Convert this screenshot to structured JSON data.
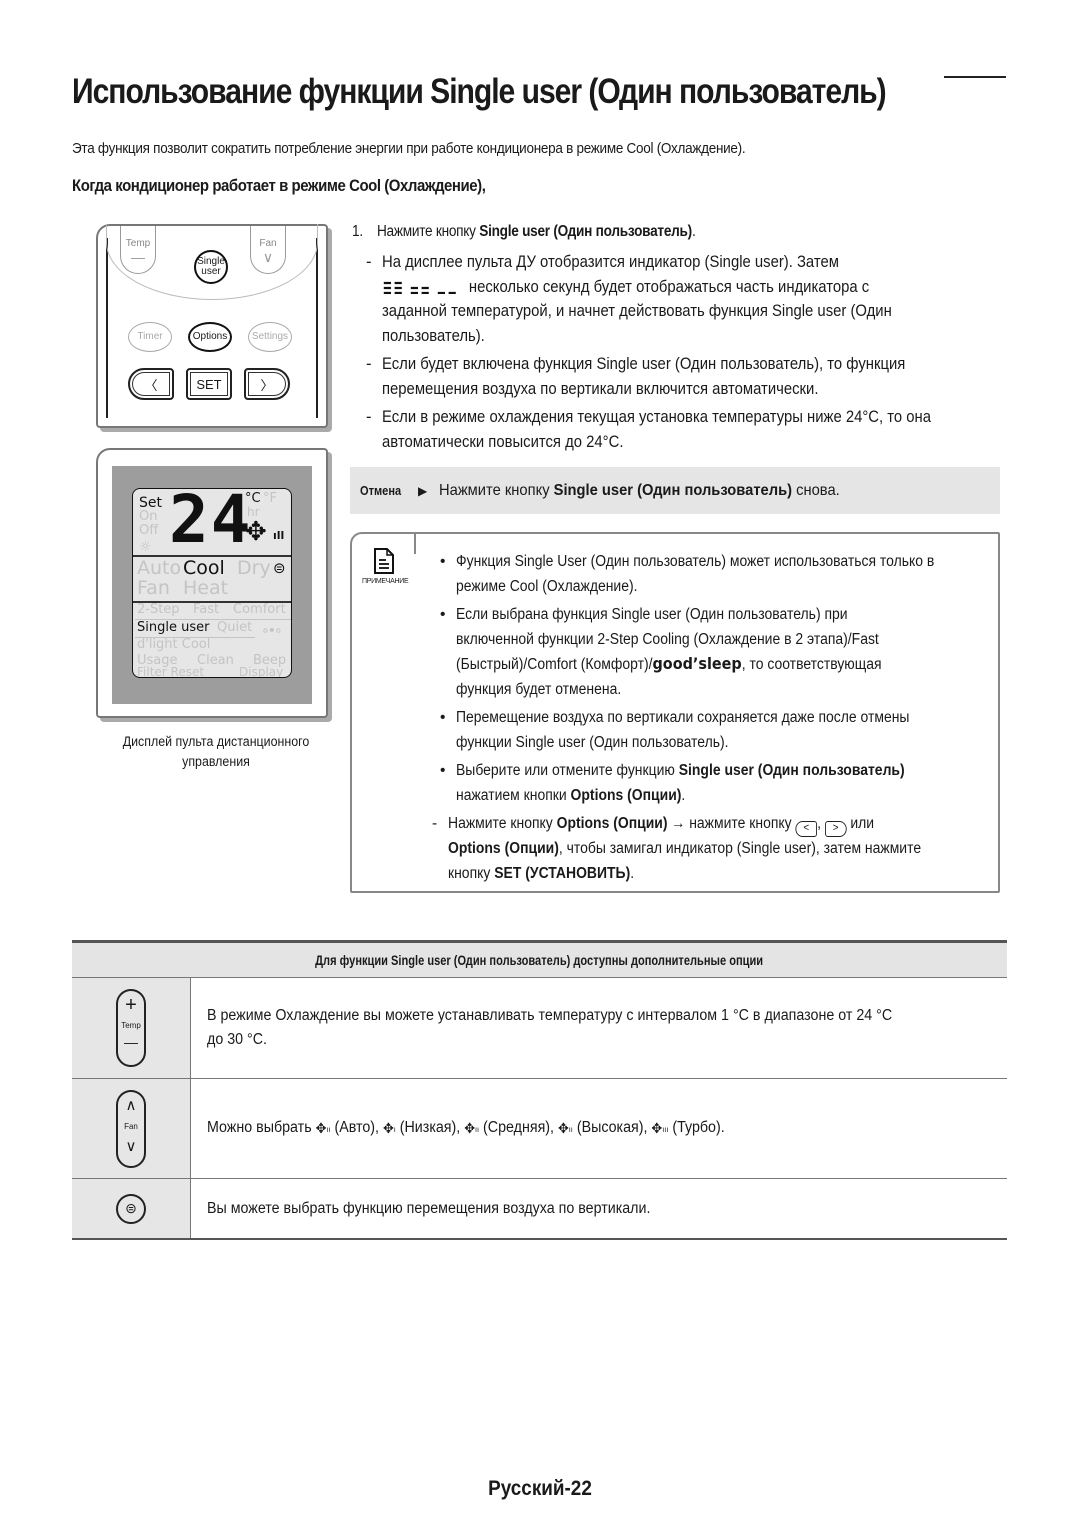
{
  "page": {
    "title": "Использование функции Single user (Один пользователь)",
    "intro": "Эта функция позволит сократить потребление энергии при работе кондиционера в режиме Cool (Охлаждение).",
    "subheading": "Когда кондиционер работает в режиме Cool (Охлаждение),",
    "footer": "Русский-22"
  },
  "remote": {
    "temp_label": "Temp",
    "fan_label": "Fan",
    "single_user_label_1": "Single",
    "single_user_label_2": "user",
    "timer_label": "Timer",
    "options_label": "Options",
    "settings_label": "Settings",
    "set_label": "SET",
    "left_arrow": "〈",
    "right_arrow": "〉",
    "minus": "—",
    "chevron_down": "∨"
  },
  "display": {
    "set": "Set",
    "on": "On",
    "off": "Off",
    "temperature": "24",
    "celsius": "°C",
    "fahrenheit": "°F",
    "hr": "hr",
    "modes_active": "Cool",
    "mode_auto": "Auto",
    "mode_dry": "Dry",
    "mode_fan": "Fan",
    "mode_heat": "Heat",
    "opt_2step": "2-Step",
    "opt_fast": "Fast",
    "opt_comfort": "Comfort",
    "opt_single_user": "Single user",
    "opt_quiet": "Quiet",
    "opt_dlight": "d'light Cool",
    "opt_usage": "Usage",
    "opt_clean": "Clean",
    "opt_beep": "Beep",
    "opt_filter_reset": "Filter Reset",
    "opt_display": "Display",
    "caption_line1": "Дисплей пульта дистанционного",
    "caption_line2": "управления"
  },
  "steps": {
    "step1_num": "1.",
    "step1_pre": "Нажмите кнопку ",
    "step1_bold": "Single user (Один пользователь)",
    "step1_post": ".",
    "dash1_a": "На дисплее пульта ДУ отобразится индикатор (Single user). Затем",
    "dash1_b": " несколько секунд будет отображаться часть индикатора с",
    "dash1_c": "заданной температурой, и начнет действовать функция Single user (Один",
    "dash1_d": "пользователь).",
    "dash2_a": "Если будет включена функция Single user (Один пользователь), то функция",
    "dash2_b": "перемещения воздуха по вертикали включится автоматически.",
    "dash3_a": "Если в режиме охлаждения текущая установка температуры ниже 24°C, то она",
    "dash3_b": "автоматически повысится до 24°C."
  },
  "cancel": {
    "label": "Отмена",
    "arrow": "▶",
    "pre": "Нажмите кнопку ",
    "bold": "Single user (Один пользователь)",
    "post": " снова."
  },
  "note": {
    "label": "ПРИМЕЧАНИЕ",
    "b1_a": "Функция Single User (Один пользователь) может использоваться только в",
    "b1_b": "режиме Cool (Охлаждение).",
    "b2_a": "Если выбрана функция Single user (Один пользователь) при",
    "b2_b": "включенной функции 2-Step Cooling (Охлаждение в 2 этапа)/Fast",
    "b2_c_pre": "(Быстрый)/Comfort (Комфорт)/",
    "b2_c_brand": "good’sleep",
    "b2_c_post": ", то соответствующая",
    "b2_d": "функция будет отменена.",
    "b3_a": "Перемещение воздуха по вертикали сохраняется даже после отмены",
    "b3_b": "функции Single user (Один пользователь).",
    "b4_a_pre": "Выберите или отмените функцию ",
    "b4_a_bold": "Single user (Один пользователь)",
    "b4_b_pre": "нажатием кнопки ",
    "b4_b_bold": "Options (Опции)",
    "b4_b_post": ".",
    "sub_a_pre": "Нажмите кнопку ",
    "sub_a_bold": "Options (Опции)",
    "sub_a_mid": " → нажмите кнопку ",
    "sub_a_sep": ", ",
    "sub_a_post": " или",
    "sub_b_bold": "Options (Опции)",
    "sub_b_post": ", чтобы замигал индикатор (Single user), затем нажмите",
    "sub_c_pre": "кнопку ",
    "sub_c_bold": "SET (УСТАНОВИТЬ)",
    "sub_c_post": ".",
    "key_left": "<",
    "key_right": ">"
  },
  "table": {
    "header": "Для функции Single user (Один пользователь) доступны дополнительные опции",
    "rows": [
      {
        "icon": "temp-button-icon",
        "key_top": "+",
        "key_mid": "Temp",
        "key_bot": "—",
        "text_a": "В режиме Охлаждение вы можете устанавливать температуру с интервалом 1 °C в диапазоне от 24 °C",
        "text_b": "до 30 °C."
      },
      {
        "icon": "fan-button-icon",
        "key_top": "∧",
        "key_mid": "Fan",
        "key_bot": "∨",
        "text_pre": "Можно выбрать ",
        "speeds": [
          "(Авто)",
          "(Низкая)",
          "(Средняя)",
          "(Высокая)",
          "(Турбо)"
        ],
        "fan_glyph": "✥"
      },
      {
        "icon": "air-swing-button-icon",
        "text": "Вы можете выбрать функцию перемещения воздуха по вертикали."
      }
    ]
  }
}
